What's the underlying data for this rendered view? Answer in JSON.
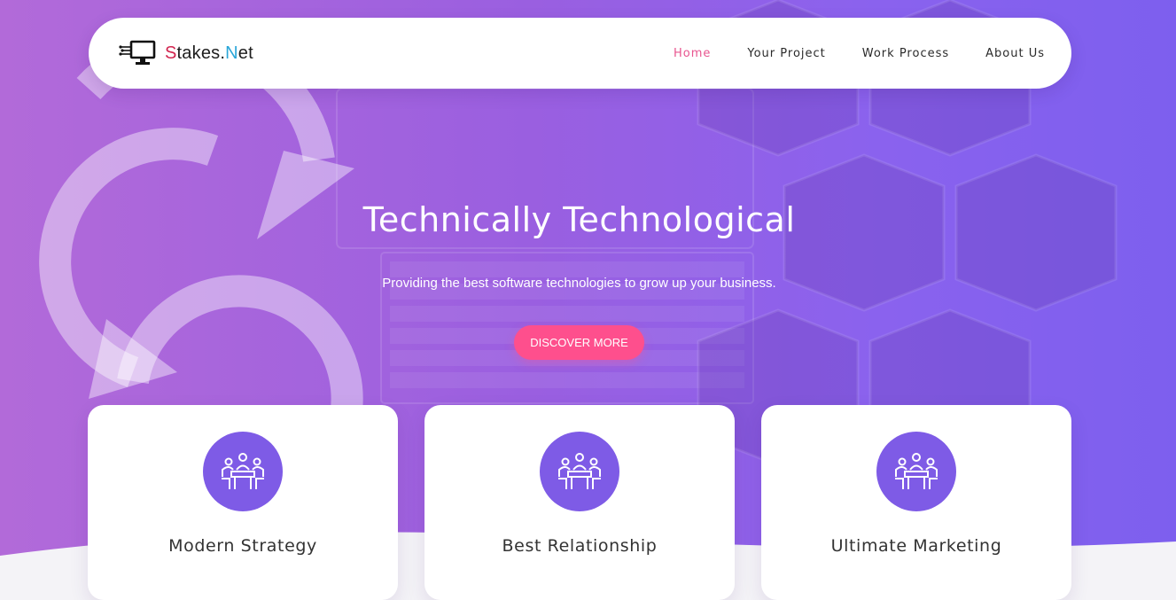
{
  "brand": {
    "prefix": "S",
    "middle": "takes.",
    "suffix_highlight": "N",
    "suffix": "et"
  },
  "nav": {
    "items": [
      {
        "label": "Home",
        "active": true
      },
      {
        "label": "Your Project",
        "active": false
      },
      {
        "label": "Work Process",
        "active": false
      },
      {
        "label": "About Us",
        "active": false
      }
    ]
  },
  "hero": {
    "title": "Technically Technological",
    "subtitle": "Providing the best software technologies to grow up your business.",
    "cta_label": "DISCOVER MORE"
  },
  "features": [
    {
      "title": "Modern Strategy",
      "icon": "team-meeting-icon"
    },
    {
      "title": "Best Relationship",
      "icon": "team-meeting-icon"
    },
    {
      "title": "Ultimate Marketing",
      "icon": "team-meeting-icon"
    }
  ],
  "colors": {
    "accent_pink": "#fe4f8d",
    "nav_active": "#e8548f",
    "icon_circle": "#7e5be6",
    "hero_gradient_start": "#b26ad9",
    "hero_gradient_end": "#7d5fee",
    "brand_s": "#d1254f",
    "brand_n": "#2aa6d8"
  }
}
